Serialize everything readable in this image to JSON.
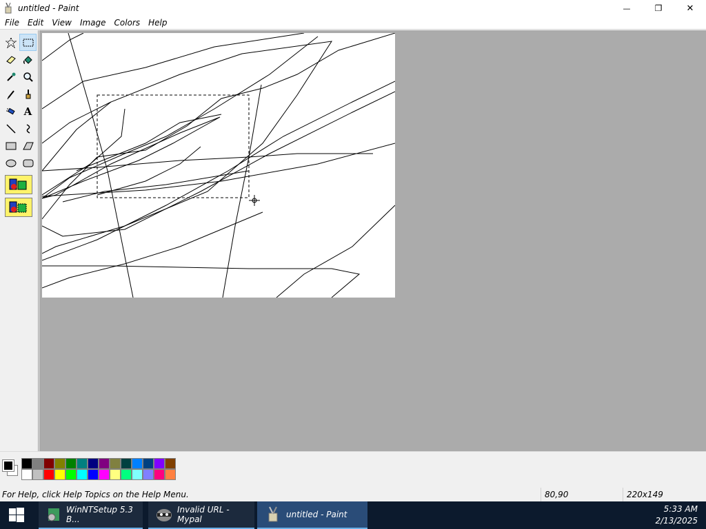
{
  "window": {
    "title": "untitled - Paint",
    "minimize_glyph": "—",
    "maximize_glyph": "❐",
    "close_glyph": "✕"
  },
  "menu": [
    "File",
    "Edit",
    "View",
    "Image",
    "Colors",
    "Help"
  ],
  "tools": [
    {
      "name": "free-form-select-tool",
      "icon": "dashed-star-icon"
    },
    {
      "name": "rect-select-tool",
      "icon": "dashed-rect-icon",
      "selected": true
    },
    {
      "name": "eraser-tool",
      "icon": "eraser-icon"
    },
    {
      "name": "fill-tool",
      "icon": "paint-bucket-icon"
    },
    {
      "name": "pick-color-tool",
      "icon": "eyedropper-icon"
    },
    {
      "name": "magnifier-tool",
      "icon": "magnifier-icon"
    },
    {
      "name": "pencil-tool",
      "icon": "pencil-icon"
    },
    {
      "name": "brush-tool",
      "icon": "brush-icon"
    },
    {
      "name": "airbrush-tool",
      "icon": "airbrush-icon"
    },
    {
      "name": "text-tool",
      "icon": "text-icon",
      "glyph": "A"
    },
    {
      "name": "line-tool",
      "icon": "line-icon"
    },
    {
      "name": "curve-tool",
      "icon": "curve-icon"
    },
    {
      "name": "rectangle-tool",
      "icon": "rectangle-icon"
    },
    {
      "name": "polygon-tool",
      "icon": "polygon-icon"
    },
    {
      "name": "ellipse-tool",
      "icon": "ellipse-icon"
    },
    {
      "name": "rounded-rect-tool",
      "icon": "rounded-rect-icon"
    }
  ],
  "palette": {
    "foreground": "#000000",
    "background": "#ffffff",
    "row1": [
      "#000000",
      "#808080",
      "#800000",
      "#808000",
      "#008000",
      "#008080",
      "#000080",
      "#800080",
      "#808040",
      "#004040",
      "#0080ff",
      "#004080",
      "#8000ff",
      "#804000"
    ],
    "row2": [
      "#ffffff",
      "#c0c0c0",
      "#ff0000",
      "#ffff00",
      "#00ff00",
      "#00ffff",
      "#0000ff",
      "#ff00ff",
      "#ffff80",
      "#00ff80",
      "#80ffff",
      "#8080ff",
      "#ff0080",
      "#ff8040"
    ]
  },
  "status": {
    "help": "For Help, click Help Topics on the Help Menu.",
    "position": "80,90",
    "selection_size": "220x149"
  },
  "taskbar": {
    "tasks": [
      {
        "label": "WinNTSetup 5.3 B...",
        "icon": "winntsetup-icon"
      },
      {
        "label": "Invalid URL - Mypal",
        "icon": "mypal-raccoon-icon"
      },
      {
        "label": "untitled - Paint",
        "icon": "paint-icon",
        "active": true
      }
    ],
    "time": "5:33 AM",
    "date": "2/13/2025"
  }
}
